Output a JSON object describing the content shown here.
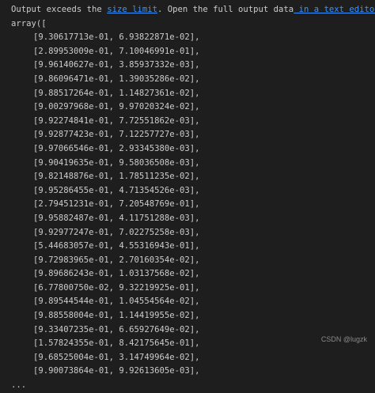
{
  "notice": {
    "prefix": "Output exceeds the ",
    "size_limit_link": "size limit",
    "middle": ". Open the full output data",
    "text_editor_link": " in a text editor"
  },
  "array": {
    "opening": "array([",
    "rows": [
      "[9.30617713e-01, 6.93822871e-02],",
      "[2.89953009e-01, 7.10046991e-01],",
      "[9.96140627e-01, 3.85937332e-03],",
      "[9.86096471e-01, 1.39035286e-02],",
      "[9.88517264e-01, 1.14827361e-02],",
      "[9.00297968e-01, 9.97020324e-02],",
      "[9.92274841e-01, 7.72551862e-03],",
      "[9.92877423e-01, 7.12257727e-03],",
      "[9.97066546e-01, 2.93345380e-03],",
      "[9.90419635e-01, 9.58036508e-03],",
      "[9.82148876e-01, 1.78511235e-02],",
      "[9.95286455e-01, 4.71354526e-03],",
      "[2.79451231e-01, 7.20548769e-01],",
      "[9.95882487e-01, 4.11751288e-03],",
      "[9.92977247e-01, 7.02275258e-03],",
      "[5.44683057e-01, 4.55316943e-01],",
      "[9.72983965e-01, 2.70160354e-02],",
      "[9.89686243e-01, 1.03137568e-02],",
      "[6.77800750e-02, 9.32219925e-01],",
      "[9.89544544e-01, 1.04554564e-02],",
      "[9.88558004e-01, 1.14419955e-02],",
      "[9.33407235e-01, 6.65927649e-02],",
      "[1.57824355e-01, 8.42175645e-01],",
      "[9.68525004e-01, 3.14749964e-02],",
      "[9.90073864e-01, 9.92613605e-03],"
    ],
    "ellipsis": "..."
  },
  "watermark": "CSDN @lugzk"
}
